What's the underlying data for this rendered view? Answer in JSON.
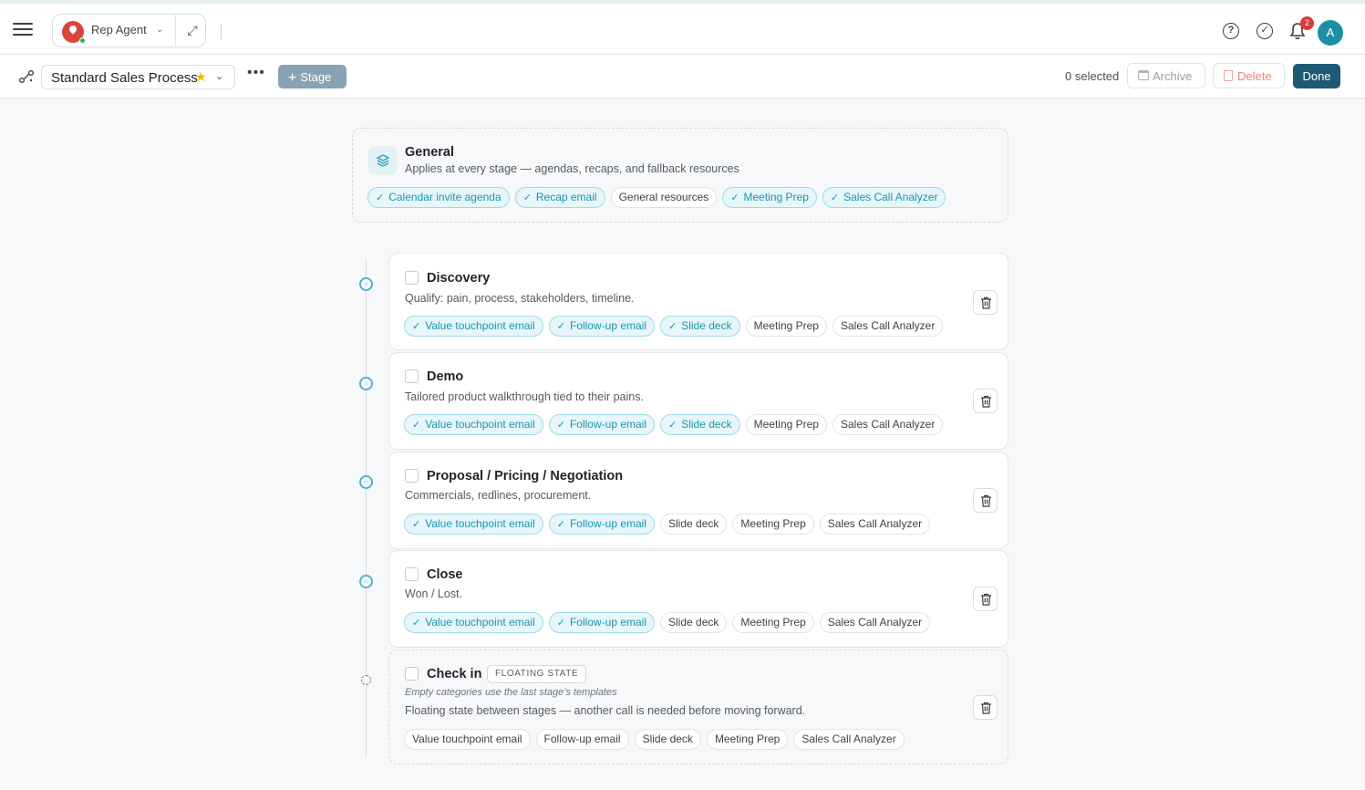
{
  "topbar": {
    "agent_name": "Rep Agent",
    "notification_count": "2",
    "user_initial": "A"
  },
  "toolbar": {
    "process_name": "Standard Sales Process",
    "more_label": "•••",
    "add_stage_label": "Stage",
    "selected_text": "0 selected",
    "archive_label": "Archive",
    "delete_label": "Delete",
    "done_label": "Done"
  },
  "general": {
    "title": "General",
    "description": "Applies at every stage — agendas, recaps, and fallback resources",
    "chips": [
      {
        "label": "Calendar invite agenda",
        "active": true
      },
      {
        "label": "Recap email",
        "active": true
      },
      {
        "label": "General resources",
        "active": false
      },
      {
        "label": "Meeting Prep",
        "active": true
      },
      {
        "label": "Sales Call Analyzer",
        "active": true
      }
    ]
  },
  "stages": [
    {
      "title": "Discovery",
      "description": "Qualify: pain, process, stakeholders, timeline.",
      "chips": [
        {
          "label": "Value touchpoint email",
          "active": true
        },
        {
          "label": "Follow-up email",
          "active": true
        },
        {
          "label": "Slide deck",
          "active": true
        },
        {
          "label": "Meeting Prep",
          "active": false
        },
        {
          "label": "Sales Call Analyzer",
          "active": false
        }
      ]
    },
    {
      "title": "Demo",
      "description": "Tailored product walkthrough tied to their pains.",
      "chips": [
        {
          "label": "Value touchpoint email",
          "active": true
        },
        {
          "label": "Follow-up email",
          "active": true
        },
        {
          "label": "Slide deck",
          "active": true
        },
        {
          "label": "Meeting Prep",
          "active": false
        },
        {
          "label": "Sales Call Analyzer",
          "active": false
        }
      ]
    },
    {
      "title": "Proposal / Pricing / Negotiation",
      "description": "Commercials, redlines, procurement.",
      "chips": [
        {
          "label": "Value touchpoint email",
          "active": true
        },
        {
          "label": "Follow-up email",
          "active": true
        },
        {
          "label": "Slide deck",
          "active": false
        },
        {
          "label": "Meeting Prep",
          "active": false
        },
        {
          "label": "Sales Call Analyzer",
          "active": false
        }
      ]
    },
    {
      "title": "Close",
      "description": "Won / Lost.",
      "chips": [
        {
          "label": "Value touchpoint email",
          "active": true
        },
        {
          "label": "Follow-up email",
          "active": true
        },
        {
          "label": "Slide deck",
          "active": false
        },
        {
          "label": "Meeting Prep",
          "active": false
        },
        {
          "label": "Sales Call Analyzer",
          "active": false
        }
      ]
    }
  ],
  "floating_stage": {
    "title": "Check in",
    "badge": "FLOATING STATE",
    "hint": "Empty categories use the last stage's templates",
    "description": "Floating state between stages — another call is needed before moving forward.",
    "chips": [
      {
        "label": "Value touchpoint email",
        "active": false
      },
      {
        "label": "Follow-up email",
        "active": false
      },
      {
        "label": "Slide deck",
        "active": false
      },
      {
        "label": "Meeting Prep",
        "active": false
      },
      {
        "label": "Sales Call Analyzer",
        "active": false
      }
    ]
  },
  "colors": {
    "accent": "#1b95b2",
    "done_button": "#1e5a73",
    "stage_button": "#8aa3b3",
    "badge": "#d93b3b"
  },
  "icons": [
    "menu-icon",
    "map-pin-icon",
    "chevron-down-icon",
    "expand-icon",
    "help-icon",
    "check-circle-icon",
    "bell-icon",
    "flow-icon",
    "star-icon",
    "layers-icon",
    "trash-icon",
    "archive-icon"
  ]
}
